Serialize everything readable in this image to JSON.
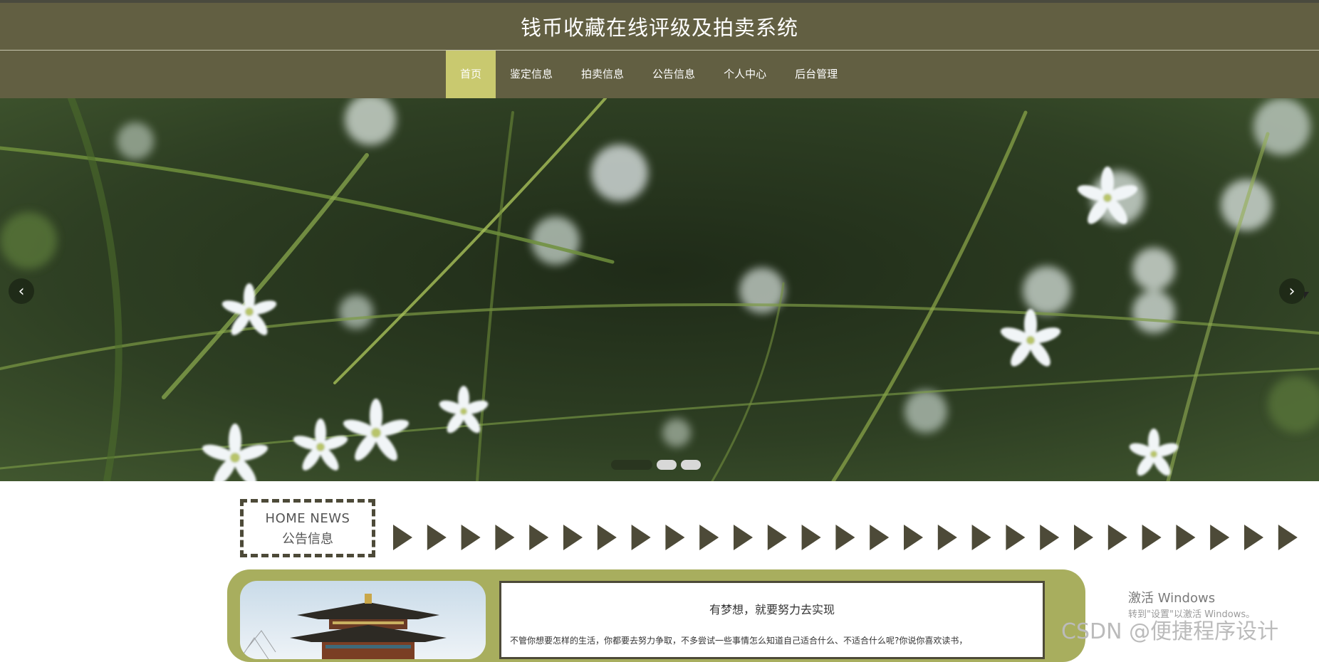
{
  "site": {
    "title": "钱币收藏在线评级及拍卖系统"
  },
  "nav": {
    "items": [
      {
        "label": "首页",
        "active": true
      },
      {
        "label": "鉴定信息"
      },
      {
        "label": "拍卖信息"
      },
      {
        "label": "公告信息"
      },
      {
        "label": "个人中心"
      },
      {
        "label": "后台管理"
      }
    ]
  },
  "carousel": {
    "prev_icon": "chevron-left-icon",
    "next_icon": "chevron-right-icon",
    "prev_glyph": "‹",
    "next_glyph": "›",
    "slide_count": 3,
    "active_index": 0
  },
  "news": {
    "label_en": "HOME NEWS",
    "label_cn": "公告信息",
    "card": {
      "title": "有梦想，就要努力去实现",
      "body": "不管你想要怎样的生活，你都要去努力争取，不多尝试一些事情怎么知道自己适合什么、不适合什么呢?你说你喜欢读书，"
    }
  },
  "watermarks": {
    "windows_line1": "激活 Windows",
    "windows_line2": "转到\"设置\"以激活 Windows。",
    "csdn": "CSDN @便捷程序设计"
  },
  "colors": {
    "header_bg": "#625f42",
    "nav_active_bg": "#c9c96f",
    "accent_green": "#a8ae5e",
    "dark_olive": "#4d4a38"
  }
}
